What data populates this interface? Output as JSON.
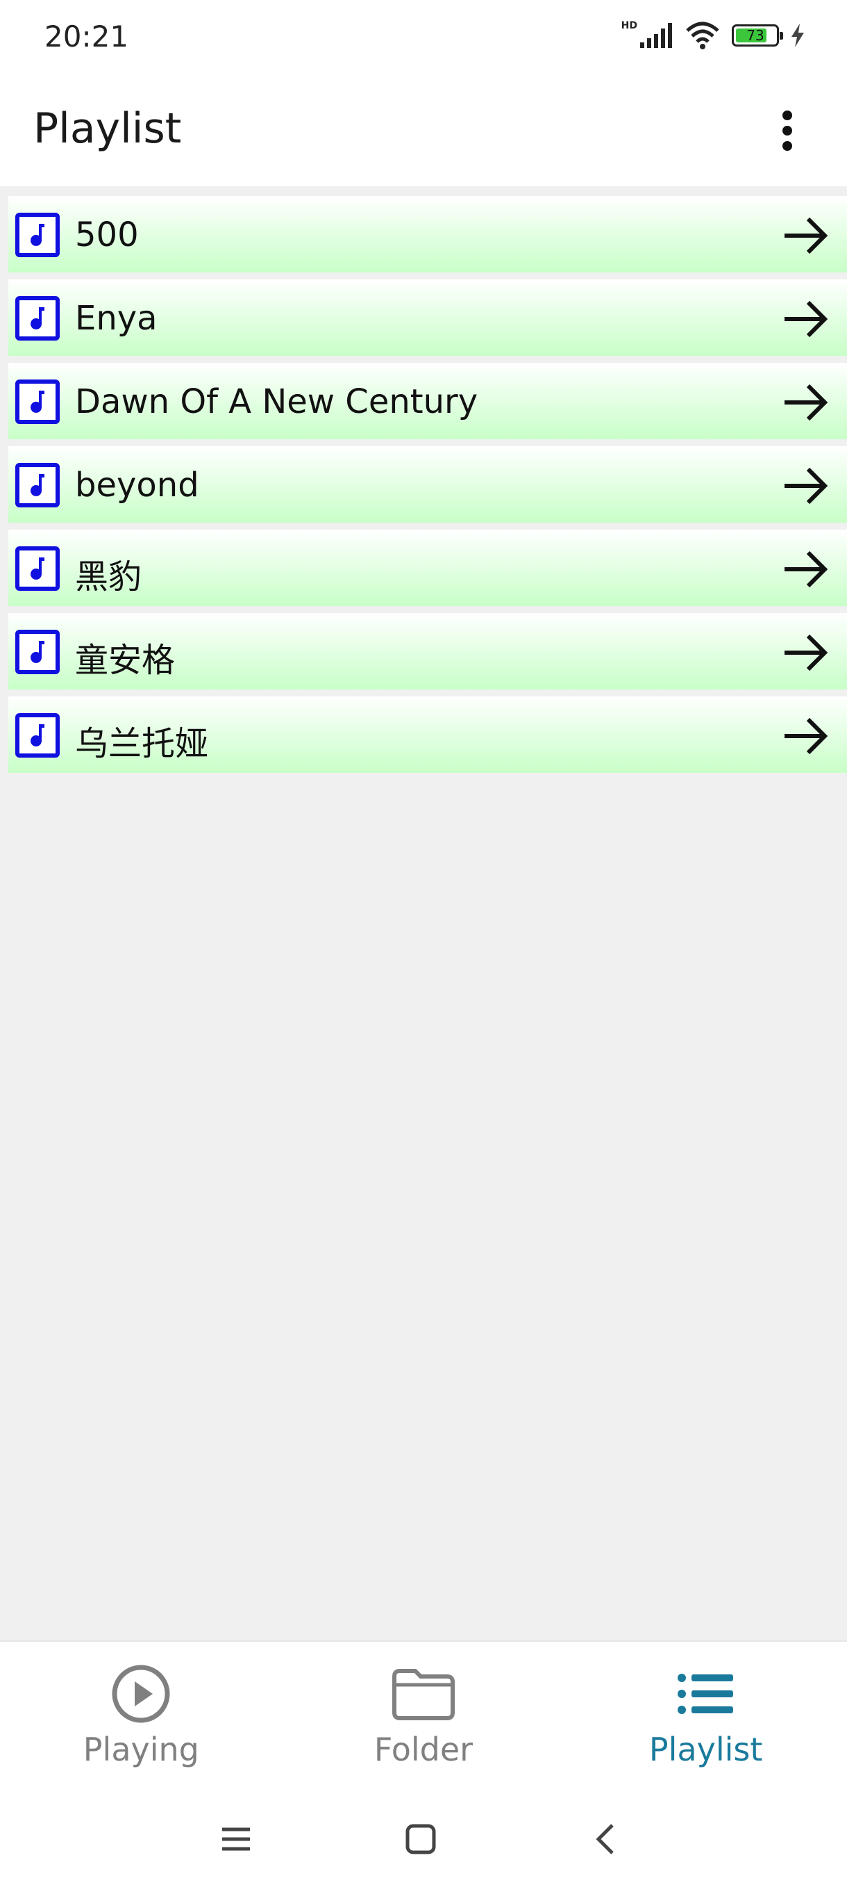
{
  "status_bar": {
    "time": "20:21",
    "battery_level": "73",
    "network_label": "HD"
  },
  "app_bar": {
    "title": "Playlist",
    "menu_icon": "more-vertical-icon"
  },
  "playlists": [
    {
      "label": "500"
    },
    {
      "label": "Enya"
    },
    {
      "label": "Dawn Of A New Century"
    },
    {
      "label": "beyond"
    },
    {
      "label": "黑豹"
    },
    {
      "label": "童安格"
    },
    {
      "label": "乌兰托娅"
    }
  ],
  "bottom_nav": {
    "tabs": [
      {
        "label": "Playing",
        "icon": "play-circle-icon",
        "active": false
      },
      {
        "label": "Folder",
        "icon": "folder-icon",
        "active": false
      },
      {
        "label": "Playlist",
        "icon": "list-icon",
        "active": true
      }
    ]
  },
  "colors": {
    "active_tab": "#1a7a9c",
    "inactive_tab": "#808080",
    "item_icon": "#1010e0",
    "item_gradient_end": "#c8ffc8"
  }
}
